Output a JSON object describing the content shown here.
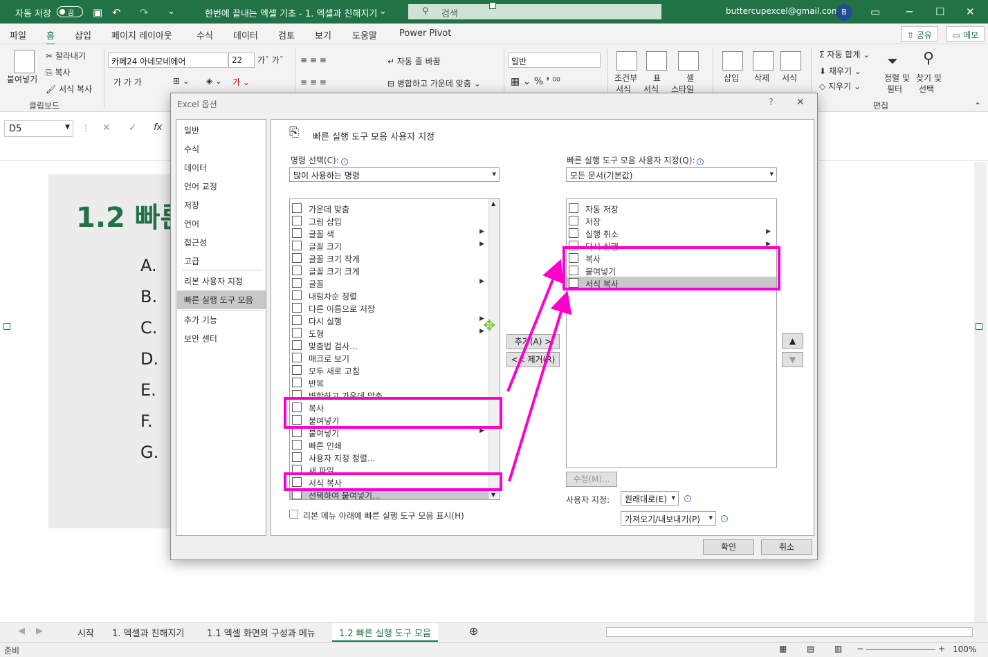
{
  "titlebar": {
    "autosave_label": "자동 저장",
    "autosave_state": "끔",
    "doc_title": "한번에 끝내는 엑셀 기초 - 1. 엑셀과 친해지기",
    "search_placeholder": "검색",
    "user_email": "buttercupexcel@gmail.com",
    "avatar_initial": "B"
  },
  "ribbon_tabs": [
    "파일",
    "홈",
    "삽입",
    "페이지 레이아웃",
    "수식",
    "데이터",
    "검토",
    "보기",
    "도움말",
    "Power Pivot"
  ],
  "ribbon_actions": {
    "share": "공유",
    "memo": "메모"
  },
  "ribbon": {
    "paste": "붙여넣기",
    "cut": "잘라내기",
    "copy": "복사",
    "format_painter": "서식 복사",
    "clipboard_group": "클립보드",
    "font_name": "카페24 아네모네에어",
    "font_size": "22",
    "wrap_text": "자동 줄 바꿈",
    "merge_center": "병합하고 가운데 맞춤",
    "number_format": "일반",
    "cond_format": "조건부",
    "cond_format2": "서식",
    "table_label": "표",
    "table_label2": "서식",
    "cell_style": "셀",
    "cell_style2": "스타일",
    "insert": "삽입",
    "delete": "삭제",
    "format": "서식",
    "autosum": "자동 합계",
    "fill": "채우기",
    "clear": "지우기",
    "sort_filter": "정렬 및",
    "sort_filter2": "필터",
    "find_select": "찾기 및",
    "find_select2": "선택",
    "edit_group": "편집"
  },
  "formula_bar": {
    "name_box": "D5"
  },
  "sheet": {
    "slide_title": "1.2 빠른",
    "letters": [
      "A.",
      "B.",
      "C.",
      "D.",
      "E.",
      "F.",
      "G."
    ]
  },
  "sheet_tabs": [
    "시작",
    "1. 엑셀과 친해지기",
    "1.1 엑셀 화면의 구성과 메뉴",
    "1.2 빠른 실행 도구 모음"
  ],
  "status": {
    "ready": "준비",
    "zoom": "100%"
  },
  "dialog": {
    "title": "Excel 옵션",
    "nav": [
      "일반",
      "수식",
      "데이터",
      "언어 교정",
      "저장",
      "언어",
      "접근성",
      "고급",
      "리본 사용자 지정",
      "빠른 실행 도구 모음",
      "추가 기능",
      "보안 센터"
    ],
    "heading": "빠른 실행 도구 모음 사용자 지정",
    "choose_label": "명령 선택(C):",
    "choose_value": "많이 사용하는 명령",
    "customize_label": "빠른 실행 도구 모음 사용자 지정(Q):",
    "customize_value": "모든 문서(기본값)",
    "commands": [
      {
        "label": "가운데 맞춤",
        "icon": "align-center-icon",
        "arrow": false
      },
      {
        "label": "그림 삽입",
        "icon": "picture-icon",
        "arrow": false
      },
      {
        "label": "글꼴 색",
        "icon": "font-color-icon",
        "arrow": true
      },
      {
        "label": "글꼴 크기",
        "icon": "font-size-icon",
        "arrow": true
      },
      {
        "label": "글꼴 크기 작게",
        "icon": "font-smaller-icon",
        "arrow": false
      },
      {
        "label": "글꼴 크기 크게",
        "icon": "font-larger-icon",
        "arrow": false
      },
      {
        "label": "글꼴",
        "icon": "font-icon",
        "arrow": true
      },
      {
        "label": "내림차순 정렬",
        "icon": "sort-desc-icon",
        "arrow": false
      },
      {
        "label": "다른 이름으로 저장",
        "icon": "save-as-icon",
        "arrow": false
      },
      {
        "label": "다시 실행",
        "icon": "redo-icon",
        "arrow": true
      },
      {
        "label": "도형",
        "icon": "shapes-icon",
        "arrow": true
      },
      {
        "label": "맞춤법 검사...",
        "icon": "spell-check-icon",
        "arrow": false
      },
      {
        "label": "매크로 보기",
        "icon": "macro-icon",
        "arrow": false
      },
      {
        "label": "모두 새로 고침",
        "icon": "refresh-all-icon",
        "arrow": false
      },
      {
        "label": "반복",
        "icon": "repeat-icon",
        "arrow": false
      },
      {
        "label": "병합하고 가운데 맞춤",
        "icon": "merge-center-icon",
        "arrow": false
      },
      {
        "label": "복사",
        "icon": "copy-icon",
        "arrow": false
      },
      {
        "label": "붙여넣기",
        "icon": "paste-icon",
        "arrow": false
      },
      {
        "label": "붙여넣기",
        "icon": "paste-icon",
        "arrow": true
      },
      {
        "label": "빠른 인쇄",
        "icon": "quick-print-icon",
        "arrow": false
      },
      {
        "label": "사용자 지정 정렬...",
        "icon": "custom-sort-icon",
        "arrow": false
      },
      {
        "label": "새 파일",
        "icon": "new-file-icon",
        "arrow": false
      },
      {
        "label": "서식 복사",
        "icon": "format-painter-icon",
        "arrow": false
      },
      {
        "label": "선택하여 붙여넣기...",
        "icon": "paste-special-icon",
        "arrow": false
      }
    ],
    "toolbar_items": [
      {
        "label": "자동 저장",
        "icon": "autosave-icon",
        "arrow": false
      },
      {
        "label": "저장",
        "icon": "save-icon",
        "arrow": false
      },
      {
        "label": "실행 취소",
        "icon": "undo-icon",
        "arrow": true
      },
      {
        "label": "다시 실행",
        "icon": "redo-icon",
        "arrow": true
      },
      {
        "label": "복사",
        "icon": "copy-icon",
        "arrow": false
      },
      {
        "label": "붙여넣기",
        "icon": "paste-icon",
        "arrow": false
      },
      {
        "label": "서식 복사",
        "icon": "format-painter-icon",
        "arrow": false
      }
    ],
    "add_button": "추가(A) >",
    "remove_button": "<< 제거(R)",
    "modify_button": "수정(M)...",
    "customizations_label": "사용자 지정:",
    "reset_value": "원래대로(E)",
    "import_export": "가져오기/내보내기(P)",
    "show_below_ribbon": "리본 메뉴 아래에 빠른 실행 도구 모음 표시(H)",
    "ok": "확인",
    "cancel": "취소",
    "help": "?",
    "close": "✕"
  },
  "colors": {
    "excel_green": "#217346",
    "highlight": "#ff00cc"
  }
}
